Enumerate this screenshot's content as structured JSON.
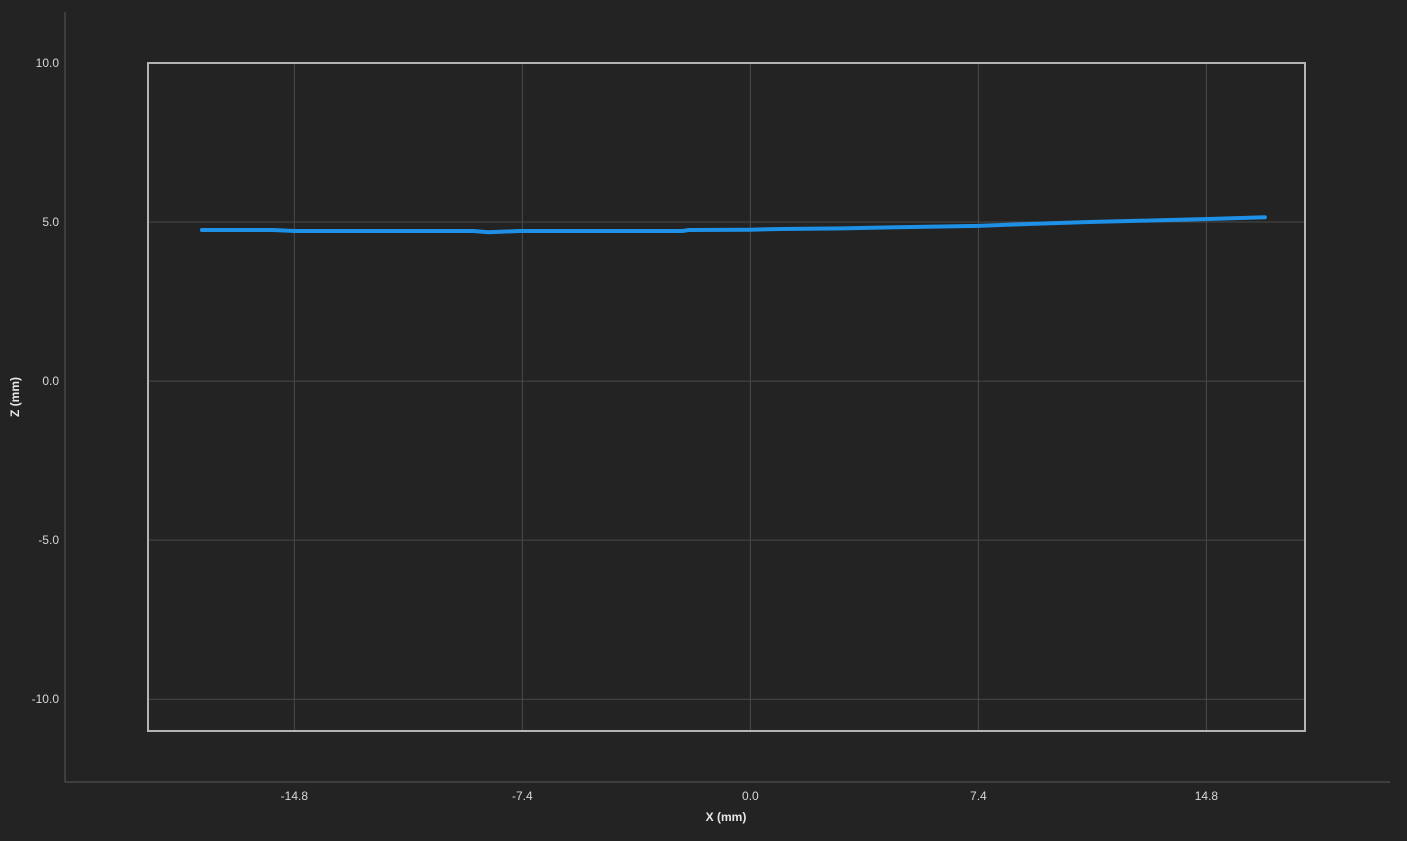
{
  "colors": {
    "background": "#232323",
    "grid": "#4a4a4a",
    "plot_border": "#b4b4b4",
    "outer_axis": "#5a5a5a",
    "series": "#1e90e6",
    "label": "#d8d8d8"
  },
  "chart_data": {
    "type": "line",
    "title": "",
    "xlabel": "X (mm)",
    "ylabel": "Z (mm)",
    "xlim": [
      -19.55,
      18.0
    ],
    "ylim": [
      -11.0,
      10.0
    ],
    "x_ticks": [
      -14.8,
      -7.4,
      0.0,
      7.4,
      14.8
    ],
    "x_tick_labels": [
      "-14.8",
      "-7.4",
      "0.0",
      "7.4",
      "14.8"
    ],
    "y_ticks": [
      10.0,
      5.0,
      0.0,
      -5.0,
      -10.0
    ],
    "y_tick_labels": [
      "10.0",
      "5.0",
      "0.0",
      "-5.0",
      "-10.0"
    ],
    "grid": true,
    "legend": "none",
    "series": [
      {
        "color": "#1e90e6",
        "x": [
          -17.8,
          -15.5,
          -14.8,
          -12.0,
          -9.0,
          -8.5,
          -7.5,
          -5.0,
          -2.2,
          -2.0,
          0.0,
          1.0,
          3.0,
          5.0,
          7.4,
          9.0,
          11.0,
          13.0,
          15.0,
          16.7
        ],
        "y": [
          4.75,
          4.75,
          4.72,
          4.72,
          4.72,
          4.68,
          4.72,
          4.72,
          4.72,
          4.75,
          4.76,
          4.78,
          4.8,
          4.84,
          4.88,
          4.94,
          5.0,
          5.05,
          5.1,
          5.15
        ]
      }
    ]
  }
}
